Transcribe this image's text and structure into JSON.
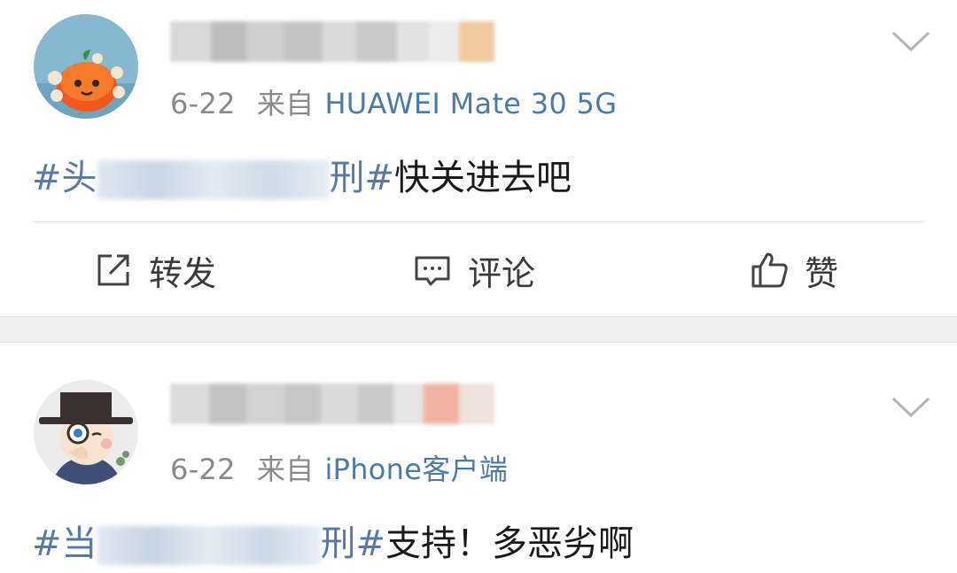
{
  "posts": [
    {
      "date": "6-22",
      "from_label": "来自",
      "device": "HUAWEI Mate 30 5G",
      "content_hash_start": "#头",
      "content_hash_end": "刑#",
      "content_text": "快关进去吧",
      "actions": {
        "repost": "转发",
        "comment": "评论",
        "like": "赞"
      }
    },
    {
      "date": "6-22",
      "from_label": "来自",
      "device": "iPhone客户端",
      "content_hash_start": "#当",
      "content_hash_end": "刑#",
      "content_text": "支持！多恶劣啊"
    }
  ],
  "colors": {
    "link_blue": "#4d7aa8",
    "hashtag_blue": "#5879a6",
    "meta_gray": "#8a8a8a",
    "band_gray": "#efefef"
  },
  "icons": [
    "repost-icon",
    "comment-icon",
    "like-icon",
    "chevron-down-icon"
  ]
}
